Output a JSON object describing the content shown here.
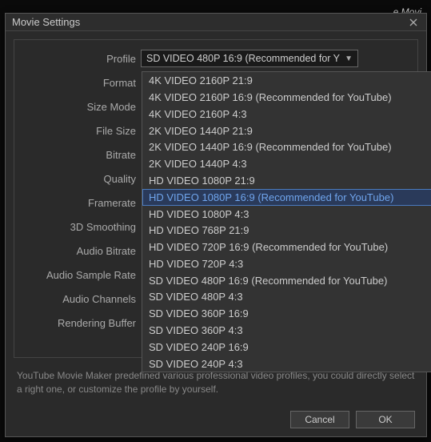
{
  "background": {
    "partial_text": "e Movi"
  },
  "dialog": {
    "title": "Movie Settings",
    "labels": {
      "profile": "Profile",
      "format": "Format",
      "size_mode": "Size Mode",
      "file_size": "File Size",
      "bitrate": "Bitrate",
      "quality": "Quality",
      "framerate": "Framerate",
      "smoothing": "3D Smoothing",
      "audio_bitrate": "Audio Bitrate",
      "audio_sample": "Audio Sample Rate",
      "audio_channels": "Audio Channels",
      "render_buffer": "Rendering Buffer"
    },
    "profile_select": {
      "value": "SD VIDEO 480P 16:9 (Recommended for Y"
    },
    "dropdown": {
      "options": [
        "4K VIDEO 2160P 21:9",
        "4K VIDEO 2160P 16:9 (Recommended for YouTube)",
        "4K VIDEO 2160P 4:3",
        "2K VIDEO 1440P 21:9",
        "2K VIDEO 1440P 16:9 (Recommended for YouTube)",
        "2K VIDEO 1440P 4:3",
        "HD VIDEO 1080P 21:9",
        "HD VIDEO 1080P 16:9 (Recommended for YouTube)",
        "HD VIDEO 1080P 4:3",
        "HD VIDEO 768P 21:9",
        "HD VIDEO 720P 16:9 (Recommended for YouTube)",
        "HD VIDEO 720P 4:3",
        "SD VIDEO 480P 16:9 (Recommended for YouTube)",
        "SD VIDEO 480P 4:3",
        "SD VIDEO 360P 16:9",
        "SD VIDEO 360P 4:3",
        "SD VIDEO 240P 16:9",
        "SD VIDEO 240P 4:3"
      ],
      "highlighted_index": 7
    },
    "description": "YouTube Movie Maker predefined various professional video profiles, you could directly select a right one, or customize the profile by yourself.",
    "buttons": {
      "ok": "OK",
      "cancel": "Cancel"
    }
  }
}
